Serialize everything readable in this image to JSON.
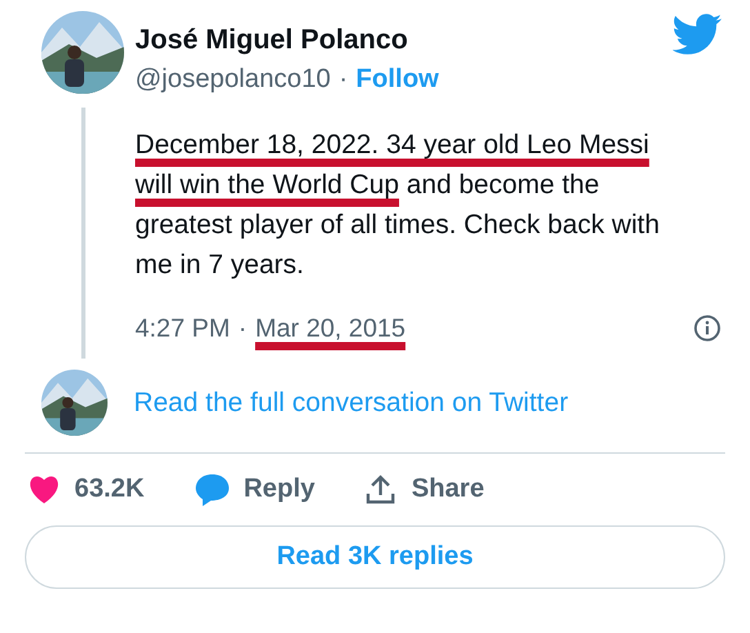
{
  "author": {
    "name": "José Miguel Polanco",
    "handle": "@josepolanco10",
    "separator": "·",
    "follow": "Follow"
  },
  "tweet": {
    "segments": [
      {
        "text": "December 18, 2022. 34 year old Leo Messi ",
        "underlined": true
      },
      {
        "text": "will win the World Cup",
        "underlined": true
      },
      {
        "text": " and become the greatest player of all times. Check back with me in 7 years.",
        "underlined": false
      }
    ],
    "time": "4:27 PM",
    "separator": "·",
    "date": {
      "text": "Mar 20, 2015",
      "underlined": true
    }
  },
  "conversation_link": "Read the full conversation on Twitter",
  "actions": [
    {
      "kind": "like",
      "label": "63.2K"
    },
    {
      "kind": "reply",
      "label": "Reply"
    },
    {
      "kind": "share",
      "label": "Share"
    }
  ],
  "replies_button": "Read 3K replies"
}
